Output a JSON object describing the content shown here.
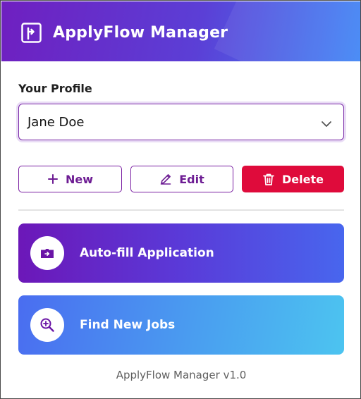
{
  "app": {
    "title": "ApplyFlow Manager",
    "logo_icon": "signpost-icon",
    "brand_gradient": [
      "#6f1fc0",
      "#3f86f6"
    ]
  },
  "profile": {
    "label": "Your Profile",
    "selected": "Jane Doe",
    "dropdown_icon": "chevron-down-icon"
  },
  "buttons": {
    "new": {
      "label": "New",
      "icon": "plus-icon"
    },
    "edit": {
      "label": "Edit",
      "icon": "pencil-icon"
    },
    "delete": {
      "label": "Delete",
      "icon": "trash-icon",
      "color": "#df0b3b"
    }
  },
  "actions": [
    {
      "label": "Auto-fill Application",
      "icon": "folder-arrow-icon"
    },
    {
      "label": "Find New Jobs",
      "icon": "zoom-in-icon"
    }
  ],
  "footer": {
    "text": "ApplyFlow Manager v1.0"
  }
}
